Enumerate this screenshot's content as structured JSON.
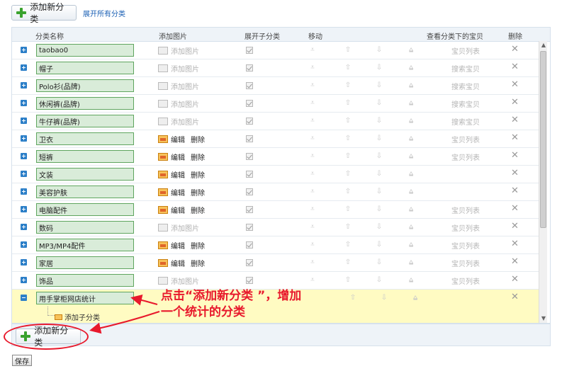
{
  "toolbar": {
    "add_category": "添加新分类",
    "expand_all": "展开所有分类"
  },
  "table": {
    "headers": {
      "name": "分类名称",
      "image": "添加图片",
      "expand": "展开子分类",
      "move": "移动",
      "view": "查看分类下的宝贝",
      "delete": "删除"
    },
    "rows": [
      {
        "name": "taobao0",
        "img_type": "add",
        "img_add": "添加图片",
        "view": "宝贝列表"
      },
      {
        "name": "帽子",
        "img_type": "add",
        "img_add": "添加图片",
        "view": "搜索宝贝"
      },
      {
        "name": "Polo衫(品牌)",
        "img_type": "add",
        "img_add": "添加图片",
        "view": "搜索宝贝"
      },
      {
        "name": "休闲裤(品牌)",
        "img_type": "add",
        "img_add": "添加图片",
        "view": "搜索宝贝"
      },
      {
        "name": "牛仔裤(品牌)",
        "img_type": "add",
        "img_add": "添加图片",
        "view": "搜索宝贝"
      },
      {
        "name": "卫衣",
        "img_type": "edit",
        "edit": "编辑",
        "remove": "删除",
        "view": "宝贝列表"
      },
      {
        "name": "短裤",
        "img_type": "edit",
        "edit": "编辑",
        "remove": "删除",
        "view": "宝贝列表"
      },
      {
        "name": "文装",
        "img_type": "edit",
        "edit": "编辑",
        "remove": "删除",
        "view": ""
      },
      {
        "name": "美容护肤",
        "img_type": "edit",
        "edit": "编辑",
        "remove": "删除",
        "view": ""
      },
      {
        "name": "电脑配件",
        "img_type": "edit",
        "edit": "编辑",
        "remove": "删除",
        "view": "宝贝列表"
      },
      {
        "name": "数码",
        "img_type": "add",
        "img_add": "添加图片",
        "view": "宝贝列表"
      },
      {
        "name": "MP3/MP4配件",
        "img_type": "edit",
        "edit": "编辑",
        "remove": "删除",
        "view": "宝贝列表"
      },
      {
        "name": "家居",
        "img_type": "edit",
        "edit": "编辑",
        "remove": "删除",
        "view": "宝贝列表"
      },
      {
        "name": "饰品",
        "img_type": "add",
        "img_add": "添加图片",
        "view": "宝贝列表"
      }
    ],
    "new_row": {
      "name": "用手掌柜网店统计",
      "add_sub": "添加子分类"
    }
  },
  "annotation": {
    "line1": "点击“添加新分类 ”，增加",
    "line2": "一个统计的分类"
  },
  "bottom": {
    "add_category": "添加新分类",
    "save": "保存"
  },
  "icons": {
    "expand": "expand-plus-icon",
    "collapse": "collapse-minus-icon",
    "delete": "close-x-icon",
    "image": "picture-icon"
  },
  "colors": {
    "accent": "#1a5fb4",
    "highlight": "#fffbc2",
    "annotation": "#e8192c",
    "input_bg": "#d9ecd9"
  }
}
